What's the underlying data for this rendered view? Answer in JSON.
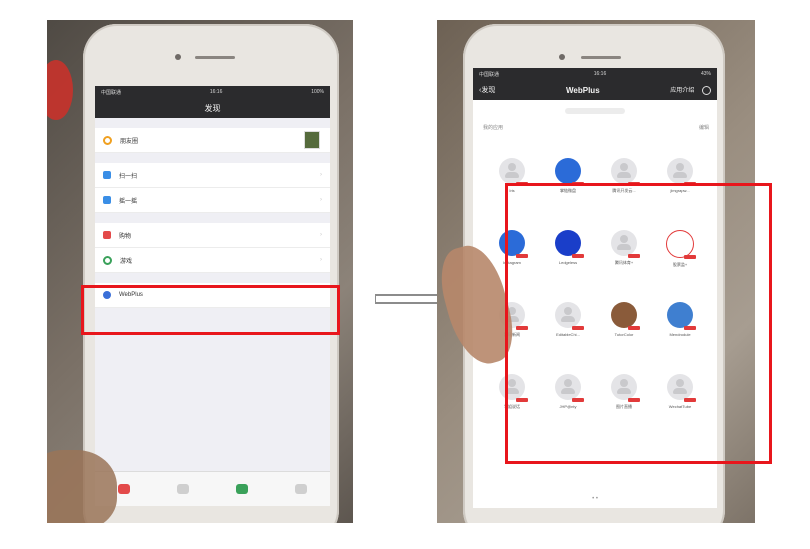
{
  "left_phone": {
    "status": {
      "carrier": "中国联通 ",
      "time": "16:16",
      "battery": "100%"
    },
    "nav_title": "发现",
    "items": [
      {
        "label": "朋友圈",
        "icon": "moments-icon",
        "color": "#3a8ee6"
      },
      {
        "label": "扫一扫",
        "icon": "scan-icon",
        "color": "#3a8ee6"
      },
      {
        "label": "摇一摇",
        "icon": "shake-icon",
        "color": "#3a8ee6"
      },
      {
        "label": "购物",
        "icon": "shopping-icon",
        "color": "#e34a4a"
      },
      {
        "label": "游戏",
        "icon": "game-icon",
        "color": "#3aa15a"
      },
      {
        "label": "WebPlus",
        "icon": "webplus-icon",
        "color": "#3a6fd8"
      }
    ]
  },
  "right_phone": {
    "status": {
      "carrier": "中国联通 ",
      "time": "16:16",
      "battery": "43%"
    },
    "nav": {
      "back_label": "发现",
      "title": "WebPlus",
      "right_label": "应用介绍"
    },
    "section_title": "我的应用",
    "section_action": "编辑",
    "apps": [
      {
        "name": "Iris"
      },
      {
        "name": "掌链微盘"
      },
      {
        "name": "腾讯开发云..."
      },
      {
        "name": "jimgrapw..."
      },
      {
        "name": "Instagram"
      },
      {
        "name": "Ledgeless"
      },
      {
        "name": "腾讯体育+"
      },
      {
        "name": "股票监+"
      },
      {
        "name": "腾讯新闻"
      },
      {
        "name": "EditableChi..."
      },
      {
        "name": "TutorColor"
      },
      {
        "name": "Mendrodule"
      },
      {
        "name": "学姐说话"
      },
      {
        "name": "JHP@nty"
      },
      {
        "name": "图片直播"
      },
      {
        "name": "WechatTube"
      }
    ],
    "page_dots": "• •"
  },
  "colors": {
    "highlight": "#e8161c",
    "nav_bg": "#2b2b2d"
  }
}
